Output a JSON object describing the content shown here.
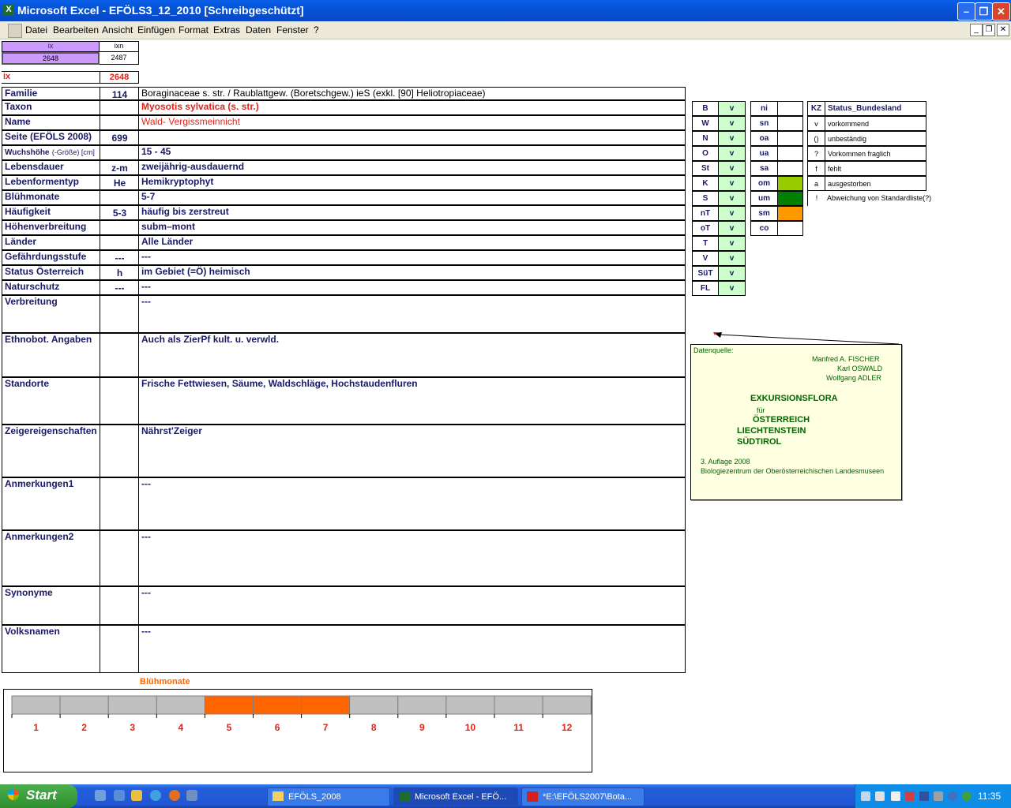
{
  "window": {
    "title": "Microsoft Excel - EFÖLS3_12_2010  [Schreibgeschützt]"
  },
  "menu": [
    "Datei",
    "Bearbeiten",
    "Ansicht",
    "Einfügen",
    "Format",
    "Extras",
    "Daten",
    "Fenster",
    "?"
  ],
  "top_cells": {
    "ix_label": "ix",
    "ixn_label": "ixn",
    "ix_value": "2648",
    "ixn_value": "2487",
    "ix_row_label": "ix",
    "ix_row_value": "2648"
  },
  "rows": [
    {
      "label": "Familie",
      "code": "114",
      "value": "Boraginaceae s. str.  /  Raublattgew. (Boretschgew.) ieS (exkl. [90] Heliotropiaceae)"
    },
    {
      "label": "Taxon",
      "code": "",
      "value": "Myosotis sylvatica (s. str.)"
    },
    {
      "label": "Name",
      "code": "",
      "value": "Wald- Vergissmeinnicht"
    },
    {
      "label": "Seite (EFÖLS 2008)",
      "code": "699",
      "value": ""
    },
    {
      "label": "Wuchshöhe",
      "label_suffix": "(-Größe) [cm]",
      "code": "",
      "value": " 15 - 45"
    },
    {
      "label": "Lebensdauer",
      "code": "z-m",
      "value": "zweijährig-ausdauernd"
    },
    {
      "label": "Lebenformentyp",
      "code": "He",
      "value": "Hemikryptophyt"
    },
    {
      "label": "Blühmonate",
      "code": "",
      "value": " 5-7"
    },
    {
      "label": "Häufigkeit",
      "code": "5-3",
      "value": "häufig bis zerstreut"
    },
    {
      "label": "Höhenverbreitung",
      "code": "",
      "value": "subm–mont"
    },
    {
      "label": "Länder",
      "code": "",
      "value": "Alle Länder"
    },
    {
      "label": "Gefährdungsstufe",
      "code": "---",
      "value": "  ---"
    },
    {
      "label": "Status Österreich",
      "code": "h",
      "value": "im Gebiet (=Ö) heimisch"
    },
    {
      "label": "Naturschutz",
      "code": "---",
      "value": " ---"
    },
    {
      "label": "Verbreitung",
      "code": "",
      "value": " ---"
    },
    {
      "label": "Ethnobot. Angaben",
      "code": "",
      "value": "Auch als ZierPf kult. u. verwld."
    },
    {
      "label": "Standorte",
      "code": "",
      "value": "Frische Fettwiesen, Säume, Waldschläge, Hochstaudenfluren"
    },
    {
      "label": "Zeigereigenschaften",
      "code": "",
      "value": "Nährst'Zeiger"
    },
    {
      "label": "Anmerkungen1",
      "code": "",
      "value": "---"
    },
    {
      "label": "Anmerkungen2",
      "code": "",
      "value": "---"
    },
    {
      "label": "Synonyme",
      "code": "",
      "value": "---"
    },
    {
      "label": "Volksnamen",
      "code": "",
      "value": "---"
    }
  ],
  "regions": [
    {
      "code": "B",
      "status": "v"
    },
    {
      "code": "W",
      "status": "v"
    },
    {
      "code": "N",
      "status": "v"
    },
    {
      "code": "O",
      "status": "v"
    },
    {
      "code": "St",
      "status": "v"
    },
    {
      "code": "K",
      "status": "v"
    },
    {
      "code": "S",
      "status": "v"
    },
    {
      "code": "nT",
      "status": "v"
    },
    {
      "code": "oT",
      "status": "v"
    },
    {
      "code": "T",
      "status": "v"
    },
    {
      "code": "V",
      "status": "v"
    },
    {
      "code": "SüT",
      "status": "v"
    },
    {
      "code": "FL",
      "status": "v"
    }
  ],
  "altitude": [
    {
      "code": "ni",
      "color": ""
    },
    {
      "code": "sn",
      "color": ""
    },
    {
      "code": "oa",
      "color": ""
    },
    {
      "code": "ua",
      "color": ""
    },
    {
      "code": "sa",
      "color": ""
    },
    {
      "code": "om",
      "color": "#99cc00"
    },
    {
      "code": "um",
      "color": "#008000"
    },
    {
      "code": "sm",
      "color": "#ff9900"
    },
    {
      "code": "co",
      "color": ""
    }
  ],
  "legend": {
    "header_code": "KZ",
    "header_label": "Status_Bundesland",
    "items": [
      {
        "code": "v",
        "label": "vorkommend"
      },
      {
        "code": "()",
        "label": "unbeständig"
      },
      {
        "code": "?",
        "label": "Vorkommen fraglich"
      },
      {
        "code": "f",
        "label": "fehlt"
      },
      {
        "code": "a",
        "label": "ausgestorben"
      },
      {
        "code": "!",
        "label": "Abweichung von Standardliste(?)"
      }
    ]
  },
  "note": {
    "source_label": "Datenquelle:",
    "authors": [
      "Manfred A. FISCHER",
      "Karl OSWALD",
      "Wolfgang ADLER"
    ],
    "title1": "EXKURSIONSFLORA",
    "fuer": "für",
    "countries": [
      "ÖSTERREICH",
      "LIECHTENSTEIN",
      "SÜDTIROL"
    ],
    "edition": "3. Auflage 2008",
    "publisher": "Biologiezentrum der Oberösterreichischen Landesmuseen"
  },
  "bloom_chart": {
    "title": "Blühmonate",
    "months": [
      "1",
      "2",
      "3",
      "4",
      "5",
      "6",
      "7",
      "8",
      "9",
      "10",
      "11",
      "12"
    ],
    "active": [
      false,
      false,
      false,
      false,
      true,
      true,
      true,
      false,
      false,
      false,
      false,
      false
    ],
    "active_color": "#ff6600",
    "inactive_color": "#c0c0c0"
  },
  "taskbar": {
    "start": "Start",
    "buttons": [
      "EFÖLS_2008",
      "Microsoft Excel - EFÖ...",
      "*E:\\EFÖLS2007\\Bota..."
    ],
    "clock": "11:35"
  }
}
